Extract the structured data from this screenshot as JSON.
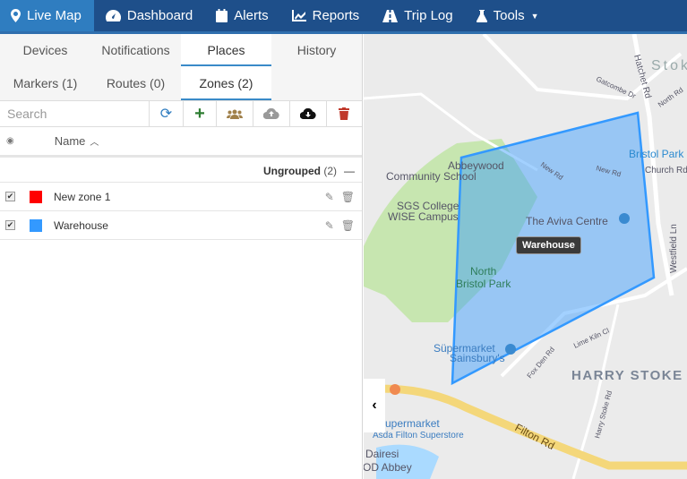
{
  "nav": [
    {
      "label": "Live Map",
      "icon": "map-marker-icon"
    },
    {
      "label": "Dashboard",
      "icon": "dashboard-icon"
    },
    {
      "label": "Alerts",
      "icon": "calendar-icon"
    },
    {
      "label": "Reports",
      "icon": "chart-icon"
    },
    {
      "label": "Trip Log",
      "icon": "road-icon"
    },
    {
      "label": "Tools",
      "icon": "flask-icon"
    }
  ],
  "tabs": [
    "Devices",
    "Notifications",
    "Places",
    "History"
  ],
  "subtabs": [
    "Markers (1)",
    "Routes (0)",
    "Zones (2)"
  ],
  "search": {
    "placeholder": "Search"
  },
  "table": {
    "name_header": "Name"
  },
  "group": {
    "name": "Ungrouped",
    "count": "(2)"
  },
  "zones": [
    {
      "name": "New zone 1",
      "color": "#ff0000",
      "checked": true
    },
    {
      "name": "Warehouse",
      "color": "#3399ff",
      "checked": true
    }
  ],
  "map": {
    "tooltip": "Warehouse",
    "labels": [
      "Abbeywood",
      "Community School",
      "SGS College",
      "WISE Campus",
      "The Aviva Centre",
      "North",
      "Bristol Park",
      "Süpermarket",
      "Sainsbury's",
      "HARRY STOKE",
      "Bristol Park",
      "Church Rd",
      "Hatchet Rd",
      "Westfield Ln",
      "Gatcombe Dr",
      "North Rd",
      "New Rd",
      "New Rd",
      "Lime Kiln Cl",
      "Fox Den Rd",
      "Harry Stoke Rd",
      "Filton Rd",
      "Supermarket",
      "Asda Filton Superstore",
      "Dairesi",
      "OD Abbey",
      "Stok"
    ]
  }
}
